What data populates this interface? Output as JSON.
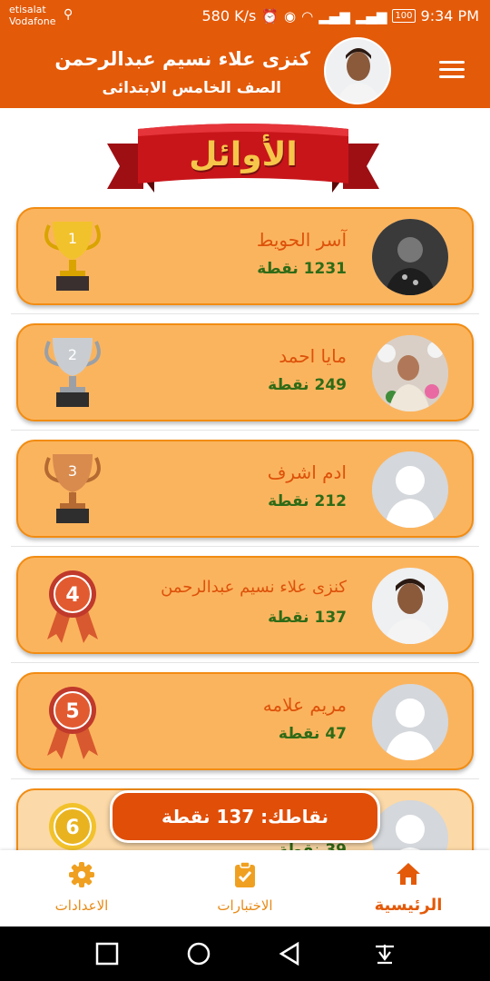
{
  "status": {
    "carrier1": "etisalat",
    "carrier2": "Vodafone",
    "speed": "580 K/s",
    "battery": "100",
    "time": "9:34 PM"
  },
  "header": {
    "student_name": "كنزى علاء نسيم عبدالرحمن",
    "grade": "الصف الخامس الابتدائى"
  },
  "banner": {
    "title": "الأوائل"
  },
  "leaders": [
    {
      "rank": "1",
      "name": "آسر الحويط",
      "points": "1231 نقطة",
      "badge": "gold-trophy"
    },
    {
      "rank": "2",
      "name": "مايا احمد",
      "points": "249 نقطة",
      "badge": "silver-trophy"
    },
    {
      "rank": "3",
      "name": "ادم اشرف",
      "points": "212 نقطة",
      "badge": "bronze-trophy"
    },
    {
      "rank": "4",
      "name": "كنزى علاء نسيم عبدالرحمن",
      "points": "137 نقطة",
      "badge": "rosette"
    },
    {
      "rank": "5",
      "name": "مريم علامه",
      "points": "47 نقطة",
      "badge": "rosette"
    },
    {
      "rank": "6",
      "name": "",
      "points": "39 نقطة",
      "badge": "gold-rosette"
    }
  ],
  "my_points": "نقاطك: 137 نقطة",
  "bottom_nav": {
    "home": "الرئيسية",
    "exams": "الاختبارات",
    "settings": "الاعدادات"
  },
  "colors": {
    "primary": "#e35a09",
    "card_bg": "#fbb45e",
    "card_border": "#f28c12",
    "points_green": "#2f6b17",
    "name_orange": "#dd520a",
    "ribbon_red": "#c8151a"
  }
}
